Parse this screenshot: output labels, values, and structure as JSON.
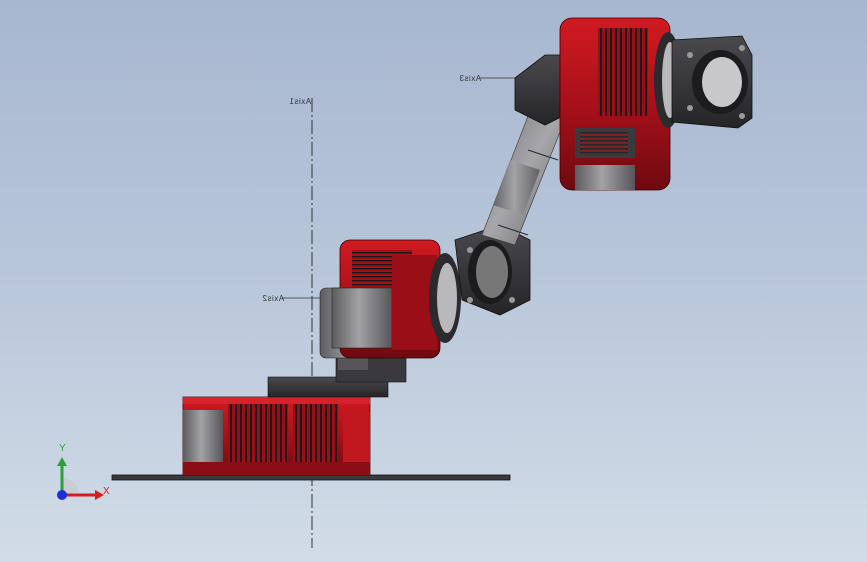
{
  "axes": {
    "axis1": "Axis1",
    "axis2": "Axis2",
    "axis3": "Axis3"
  },
  "triad": {
    "x_label": "X",
    "y_label": "Y"
  },
  "colors": {
    "background_top": "#a7b7cf",
    "robot_red": "#b5121b",
    "robot_dark": "#2f2f33",
    "robot_gray": "#7a7a7e",
    "triad_x": "#d21e1e",
    "triad_y": "#27a33a",
    "triad_z": "#1c2fd6"
  }
}
